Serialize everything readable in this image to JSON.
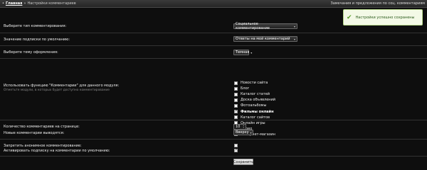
{
  "header": {
    "home_label": "Главная",
    "separator": "»",
    "current_page": "Настройки комментариев",
    "right_link": "Замечания и предложения по соц. комментариям"
  },
  "notice": {
    "icon": "check-icon",
    "text": "Настройки успешно сохранены"
  },
  "settings": {
    "comment_type": {
      "label": "Выберите тип комментирования:",
      "value": "Социальное комментирование"
    },
    "subscription_default": {
      "label": "Значение подписки по умолчанию:",
      "value": "Ответы на мой комментарий"
    },
    "theme": {
      "label": "Выберите тему оформления:",
      "value": "Темная"
    },
    "modules": {
      "label": "Использовать функцию \"Комментарии\" для данного модуля:",
      "hint": "Отметьте модули, в которых будет доступно комментирование",
      "items": [
        {
          "label": "Новости сайта",
          "checked": false
        },
        {
          "label": "Блог",
          "checked": false
        },
        {
          "label": "Каталог статей",
          "checked": false
        },
        {
          "label": "Доска объявлений",
          "checked": false
        },
        {
          "label": "Фотоальбомы",
          "checked": false
        },
        {
          "label": "Фильмы онлайн",
          "checked": true
        },
        {
          "label": "Каталог сайтов",
          "checked": false
        },
        {
          "label": "Онлайн игры",
          "checked": false
        },
        {
          "label": "Видео",
          "checked": false
        },
        {
          "label": "Интернет-магазин",
          "checked": false
        }
      ]
    },
    "per_page": {
      "label": "Количество комментариев на странице:",
      "value": "10"
    },
    "new_position": {
      "label": "Новые комментарии выводятся:",
      "value": "Вверху"
    },
    "anonymous": {
      "label": "Запретить анонимное комментирование:",
      "checked": false
    },
    "auto_subscribe": {
      "label": "Активировать подписку на комментарии по умолчанию:",
      "checked": true
    }
  },
  "save_label": "Сохранить"
}
